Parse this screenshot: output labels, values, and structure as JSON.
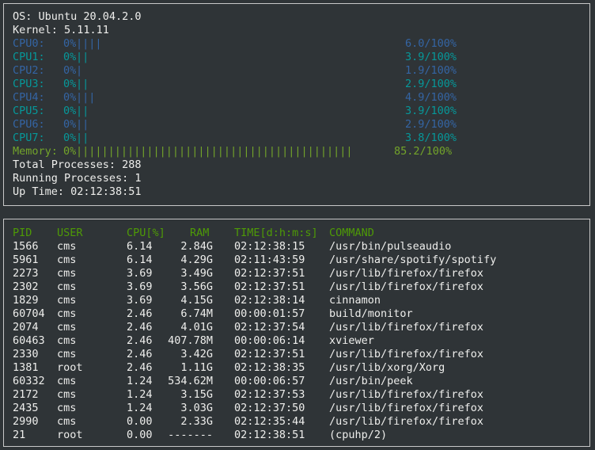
{
  "system": {
    "os": "OS: Ubuntu 20.04.2.0",
    "kernel": "Kernel: 5.11.11",
    "cpus": [
      {
        "label": "CPU0:",
        "pct": "0%",
        "bars": "||||",
        "value": "6.0/100%",
        "color": "#3465a4"
      },
      {
        "label": "CPU1:",
        "pct": "0%",
        "bars": "||",
        "value": "3.9/100%",
        "color": "#06989a"
      },
      {
        "label": "CPU2:",
        "pct": "0%",
        "bars": "|",
        "value": "1.9/100%",
        "color": "#3465a4"
      },
      {
        "label": "CPU3:",
        "pct": "0%",
        "bars": "||",
        "value": "2.9/100%",
        "color": "#06989a"
      },
      {
        "label": "CPU4:",
        "pct": "0%",
        "bars": "|||",
        "value": "4.9/100%",
        "color": "#3465a4"
      },
      {
        "label": "CPU5:",
        "pct": "0%",
        "bars": "||",
        "value": "3.9/100%",
        "color": "#06989a"
      },
      {
        "label": "CPU6:",
        "pct": "0%",
        "bars": "||",
        "value": "2.9/100%",
        "color": "#3465a4"
      },
      {
        "label": "CPU7:",
        "pct": "0%",
        "bars": "||",
        "value": "3.8/100%",
        "color": "#06989a"
      }
    ],
    "memory": {
      "label": "Memory:",
      "pct": "0%",
      "bars": "|||||||||||||||||||||||||||||||||||||||||||",
      "value": "85.2/100%",
      "color": "#73a42a"
    },
    "total_processes": "Total Processes: 288",
    "running_processes": "Running Processes: 1",
    "uptime": "Up Time: 02:12:38:51"
  },
  "processes": {
    "headers": {
      "pid": "PID",
      "user": "USER",
      "cpu": "CPU[%]",
      "ram": "RAM",
      "time": "TIME[d:h:m:s]",
      "command": "COMMAND"
    },
    "rows": [
      {
        "pid": "1566",
        "user": "cms",
        "cpu": "6.14",
        "ram": "2.84G",
        "time": "02:12:38:15",
        "command": "/usr/bin/pulseaudio"
      },
      {
        "pid": "5961",
        "user": "cms",
        "cpu": "6.14",
        "ram": "4.29G",
        "time": "02:11:43:59",
        "command": "/usr/share/spotify/spotify"
      },
      {
        "pid": "2273",
        "user": "cms",
        "cpu": "3.69",
        "ram": "3.49G",
        "time": "02:12:37:51",
        "command": "/usr/lib/firefox/firefox"
      },
      {
        "pid": "2302",
        "user": "cms",
        "cpu": "3.69",
        "ram": "3.56G",
        "time": "02:12:37:51",
        "command": "/usr/lib/firefox/firefox"
      },
      {
        "pid": "1829",
        "user": "cms",
        "cpu": "3.69",
        "ram": "4.15G",
        "time": "02:12:38:14",
        "command": "cinnamon"
      },
      {
        "pid": "60704",
        "user": "cms",
        "cpu": "2.46",
        "ram": "6.74M",
        "time": "00:00:01:57",
        "command": "build/monitor"
      },
      {
        "pid": "2074",
        "user": "cms",
        "cpu": "2.46",
        "ram": "4.01G",
        "time": "02:12:37:54",
        "command": "/usr/lib/firefox/firefox"
      },
      {
        "pid": "60463",
        "user": "cms",
        "cpu": "2.46",
        "ram": "407.78M",
        "time": "00:00:06:14",
        "command": "xviewer"
      },
      {
        "pid": "2330",
        "user": "cms",
        "cpu": "2.46",
        "ram": "3.42G",
        "time": "02:12:37:51",
        "command": "/usr/lib/firefox/firefox"
      },
      {
        "pid": "1381",
        "user": "root",
        "cpu": "2.46",
        "ram": "1.11G",
        "time": "02:12:38:35",
        "command": "/usr/lib/xorg/Xorg"
      },
      {
        "pid": "60332",
        "user": "cms",
        "cpu": "1.24",
        "ram": "534.62M",
        "time": "00:00:06:57",
        "command": "/usr/bin/peek"
      },
      {
        "pid": "2172",
        "user": "cms",
        "cpu": "1.24",
        "ram": "3.15G",
        "time": "02:12:37:53",
        "command": "/usr/lib/firefox/firefox"
      },
      {
        "pid": "2435",
        "user": "cms",
        "cpu": "1.24",
        "ram": "3.03G",
        "time": "02:12:37:50",
        "command": "/usr/lib/firefox/firefox"
      },
      {
        "pid": "2990",
        "user": "cms",
        "cpu": "0.00",
        "ram": "2.33G",
        "time": "02:12:35:44",
        "command": "/usr/lib/firefox/firefox"
      },
      {
        "pid": "21",
        "user": "root",
        "cpu": "0.00",
        "ram": "-------",
        "time": "02:12:38:51",
        "command": "(cpuhp/2)"
      }
    ]
  }
}
